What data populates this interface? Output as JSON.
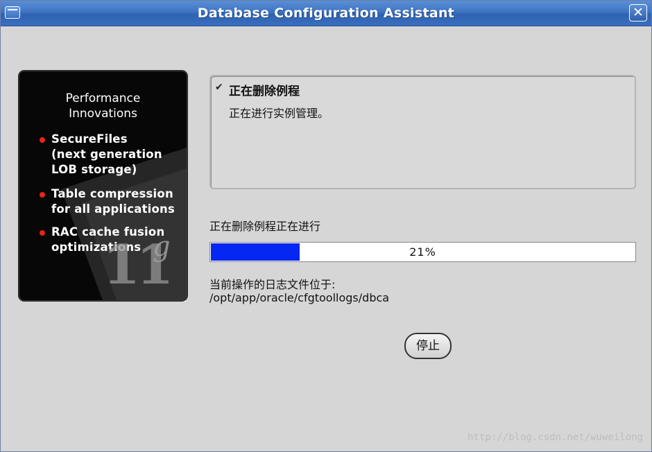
{
  "window": {
    "title": "Database Configuration Assistant"
  },
  "banner": {
    "title_line1": "Performance",
    "title_line2": "Innovations",
    "bullets": [
      {
        "text": "SecureFiles\n(next generation\nLOB storage)"
      },
      {
        "text": "Table compression\nfor all applications"
      },
      {
        "text": "RAC cache fusion\noptimizations"
      }
    ],
    "logo_number": "11",
    "logo_letter": "g",
    "bullet_color": "#e8231b"
  },
  "step": {
    "check_icon": "checkmark-icon",
    "title": "正在删除例程",
    "detail": "正在进行实例管理。"
  },
  "progress": {
    "label": "正在删除例程正在进行",
    "percent": 21,
    "percent_text": "21%",
    "fill_color": "#0527f2"
  },
  "log": {
    "label": "当前操作的日志文件位于:",
    "path": "/opt/app/oracle/cfgtoollogs/dbca"
  },
  "buttons": {
    "stop": "停止"
  },
  "watermark": "http://blog.csdn.net/wuweilong"
}
